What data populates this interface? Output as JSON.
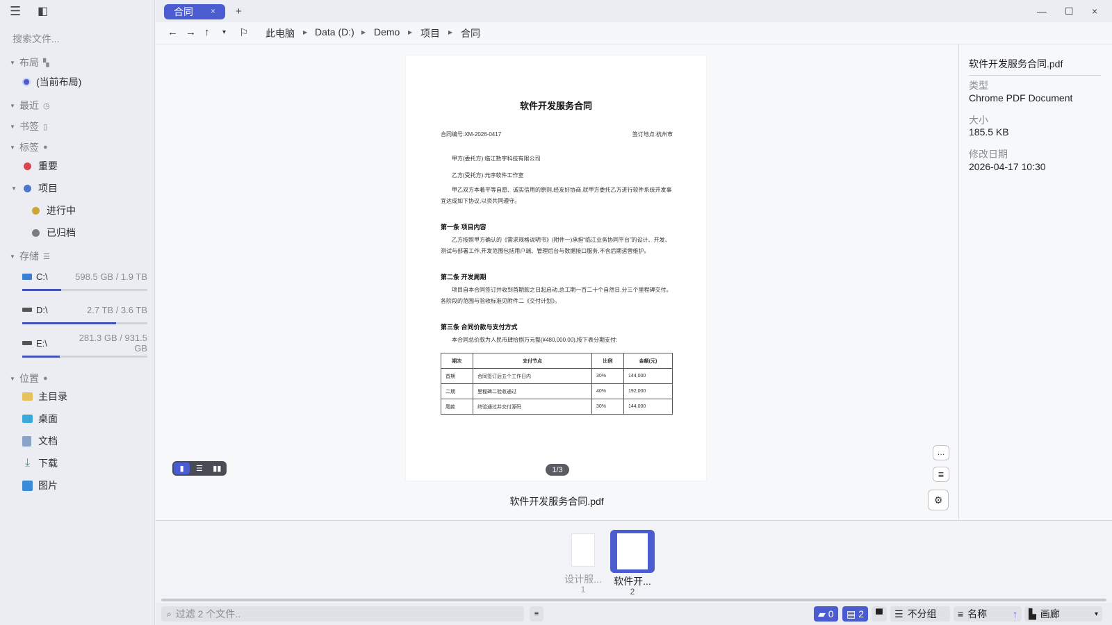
{
  "sidebar": {
    "search_placeholder": "搜索文件...",
    "sections": {
      "layout": "布局",
      "recent": "最近",
      "bookmarks": "书签",
      "tags": "标签",
      "storage": "存储",
      "places": "位置"
    },
    "layout_current": "(当前布局)",
    "tags": [
      {
        "label": "重要",
        "color": "#d64550"
      },
      {
        "label": "项目",
        "color": "#4a78c8"
      },
      {
        "label": "进行中",
        "color": "#c9a53a"
      },
      {
        "label": "已归档",
        "color": "#7b7d86"
      }
    ],
    "drives": [
      {
        "label": "C:\\",
        "capacity": "598.5 GB / 1.9 TB",
        "used_fraction": 0.31
      },
      {
        "label": "D:\\",
        "capacity": "2.7 TB / 3.6 TB",
        "used_fraction": 0.75
      },
      {
        "label": "E:\\",
        "capacity": "281.3 GB / 931.5 GB",
        "used_fraction": 0.3
      }
    ],
    "places": [
      {
        "label": "主目录",
        "icon": "folder-icon",
        "color": "#e8c15a"
      },
      {
        "label": "桌面",
        "icon": "desktop-icon",
        "color": "#3aa8d8"
      },
      {
        "label": "文档",
        "icon": "document-icon",
        "color": "#8aa4c8"
      },
      {
        "label": "下载",
        "icon": "download-icon",
        "color": "#3aa070"
      },
      {
        "label": "图片",
        "icon": "pictures-icon",
        "color": "#3a8ad8"
      }
    ]
  },
  "tabs": [
    {
      "label": "合同",
      "close": "×"
    }
  ],
  "tab_add": "+",
  "window": {
    "minimize": "—",
    "maximize": "☐",
    "close": "×"
  },
  "nav": {
    "back": "←",
    "forward": "→",
    "up": "↑",
    "history": "▾",
    "bookmark": "⚐"
  },
  "breadcrumb": [
    "此电脑",
    "Data (D:)",
    "Demo",
    "项目",
    "合同"
  ],
  "document": {
    "title": "软件开发服务合同",
    "contract_no": "合同编号:XM-2026-0417",
    "sign_place": "签订地点:杭州市",
    "party_a": "甲方(委托方):临江数字科技有限公司",
    "party_b": "乙方(受托方):元序软件工作室",
    "intro": "甲乙双方本着平等自愿、诚实信用的原则,经友好协商,就甲方委托乙方进行软件系统开发事宜达成如下协议,以资共同遵守。",
    "sec1_title": "第一条 项目内容",
    "sec1_text": "乙方按照甲方确认的《需求规格说明书》(附件一)承担“临江业务协同平台”的设计、开发、测试与部署工作,开发范围包括用户端、管理后台与数据接口服务,不含后期运营维护。",
    "sec2_title": "第二条 开发周期",
    "sec2_text": "项目自本合同签订并收到首期款之日起启动,总工期一百二十个自然日,分三个里程碑交付。各阶段的范围与验收标准见附件二《交付计划》。",
    "sec3_title": "第三条 合同价款与支付方式",
    "sec3_text": "本合同总价款为人民币肆拾捌万元整(¥480,000.00),按下表分期支付:",
    "table": {
      "headers": [
        "期次",
        "支付节点",
        "比例",
        "金额(元)"
      ],
      "rows": [
        [
          "首期",
          "合同签订后五个工作日内",
          "30%",
          "144,000"
        ],
        [
          "二期",
          "里程碑二验收通过",
          "40%",
          "192,000"
        ],
        [
          "尾款",
          "终验通过并交付源码",
          "30%",
          "144,000"
        ]
      ]
    },
    "page_indicator": "1/3"
  },
  "preview_filename": "软件开发服务合同.pdf",
  "preview_buttons": {
    "more": "…",
    "details": "≣",
    "settings": "⚙"
  },
  "info": {
    "filename": "软件开发服务合同.pdf",
    "type_label": "类型",
    "type_value": "Chrome PDF Document",
    "size_label": "大小",
    "size_value": "185.5 KB",
    "date_label": "修改日期",
    "date_value": "2026-04-17 10:30"
  },
  "thumbnails": [
    {
      "label": "设计服...",
      "index": "1"
    },
    {
      "label": "软件开...",
      "index": "2"
    }
  ],
  "statusbar": {
    "filter_placeholder": "过滤 2 个文件..",
    "folders_count": "0",
    "files_count": "2",
    "group": "不分组",
    "sort": "名称",
    "sort_dir": "↑",
    "view": "画廊",
    "view_arrow": "▾"
  }
}
